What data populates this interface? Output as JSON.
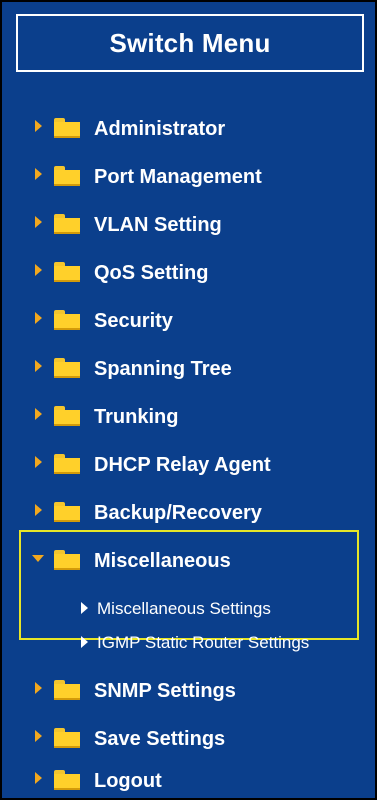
{
  "menu": {
    "title": "Switch Menu",
    "items": [
      {
        "label": "Administrator",
        "expanded": false
      },
      {
        "label": "Port Management",
        "expanded": false
      },
      {
        "label": "VLAN Setting",
        "expanded": false
      },
      {
        "label": "QoS Setting",
        "expanded": false
      },
      {
        "label": "Security",
        "expanded": false
      },
      {
        "label": "Spanning Tree",
        "expanded": false
      },
      {
        "label": "Trunking",
        "expanded": false
      },
      {
        "label": "DHCP Relay Agent",
        "expanded": false
      },
      {
        "label": "Backup/Recovery",
        "expanded": false
      },
      {
        "label": "Miscellaneous",
        "expanded": true,
        "subitems": [
          {
            "label": "Miscellaneous Settings"
          },
          {
            "label": "IGMP Static Router Settings"
          }
        ]
      },
      {
        "label": "SNMP Settings",
        "expanded": false
      },
      {
        "label": "Save Settings",
        "expanded": false
      },
      {
        "label": "Logout",
        "expanded": false
      }
    ]
  },
  "colors": {
    "panel_background": "#0b3f8c",
    "folder": "#ffd02a",
    "arrow": "#f2a81f",
    "highlight_border": "#e8e627",
    "text": "#ffffff"
  },
  "icons": {
    "collapsed": "chevron-right-icon",
    "expanded": "chevron-down-icon",
    "folder": "folder-icon",
    "subitem": "triangle-right-icon"
  }
}
